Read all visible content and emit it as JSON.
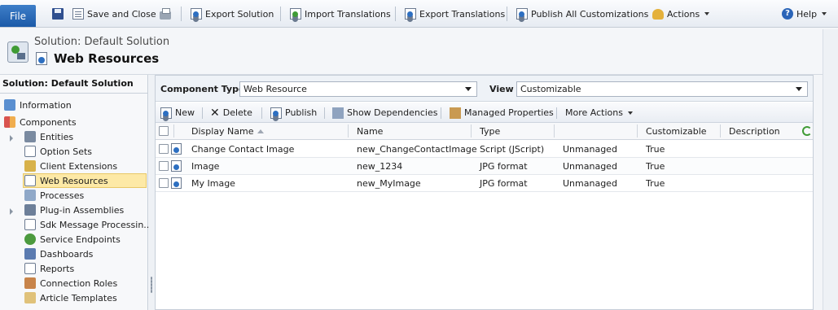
{
  "ribbon": {
    "file": "File",
    "save_and_close": "Save and Close",
    "export_solution": "Export Solution",
    "import_translations": "Import Translations",
    "export_translations": "Export Translations",
    "publish_all": "Publish All Customizations",
    "actions": "Actions",
    "help": "Help"
  },
  "header": {
    "subtitle": "Solution: Default Solution",
    "title": "Web Resources"
  },
  "sidebar": {
    "title": "Solution: Default Solution",
    "items": [
      {
        "label": "Information",
        "icon": "information-icon"
      },
      {
        "label": "Components",
        "icon": "components-icon"
      },
      {
        "label": "Entities",
        "icon": "entities-icon"
      },
      {
        "label": "Option Sets",
        "icon": "option-sets-icon"
      },
      {
        "label": "Client Extensions",
        "icon": "client-extensions-icon"
      },
      {
        "label": "Web Resources",
        "icon": "web-resources-icon"
      },
      {
        "label": "Processes",
        "icon": "processes-icon"
      },
      {
        "label": "Plug-in Assemblies",
        "icon": "plugin-assemblies-icon"
      },
      {
        "label": "Sdk Message Processin...",
        "icon": "sdk-message-icon"
      },
      {
        "label": "Service Endpoints",
        "icon": "service-endpoints-icon"
      },
      {
        "label": "Dashboards",
        "icon": "dashboards-icon"
      },
      {
        "label": "Reports",
        "icon": "reports-icon"
      },
      {
        "label": "Connection Roles",
        "icon": "connection-roles-icon"
      },
      {
        "label": "Article Templates",
        "icon": "article-templates-icon"
      }
    ]
  },
  "filter": {
    "component_type_label": "Component Type",
    "component_type_value": "Web Resource",
    "view_label": "View",
    "view_value": "Customizable"
  },
  "commands": {
    "new": "New",
    "delete": "Delete",
    "publish": "Publish",
    "show_dependencies": "Show Dependencies",
    "managed_properties": "Managed Properties",
    "more_actions": "More Actions"
  },
  "grid": {
    "columns": [
      "Display Name",
      "Name",
      "Type",
      "",
      "Customizable",
      "Description"
    ],
    "rows": [
      [
        "Change Contact Image",
        "new_ChangeContactImage",
        "Script (JScript)",
        "Unmanaged",
        "True",
        ""
      ],
      [
        "Image",
        "new_1234",
        "JPG format",
        "Unmanaged",
        "True",
        ""
      ],
      [
        "My Image",
        "new_MyImage",
        "JPG format",
        "Unmanaged",
        "True",
        ""
      ]
    ]
  },
  "colors": {
    "selected_nav_bg": "#fde9a6",
    "file_button": "#1b5aa8",
    "accent_green": "#3f9b35"
  }
}
